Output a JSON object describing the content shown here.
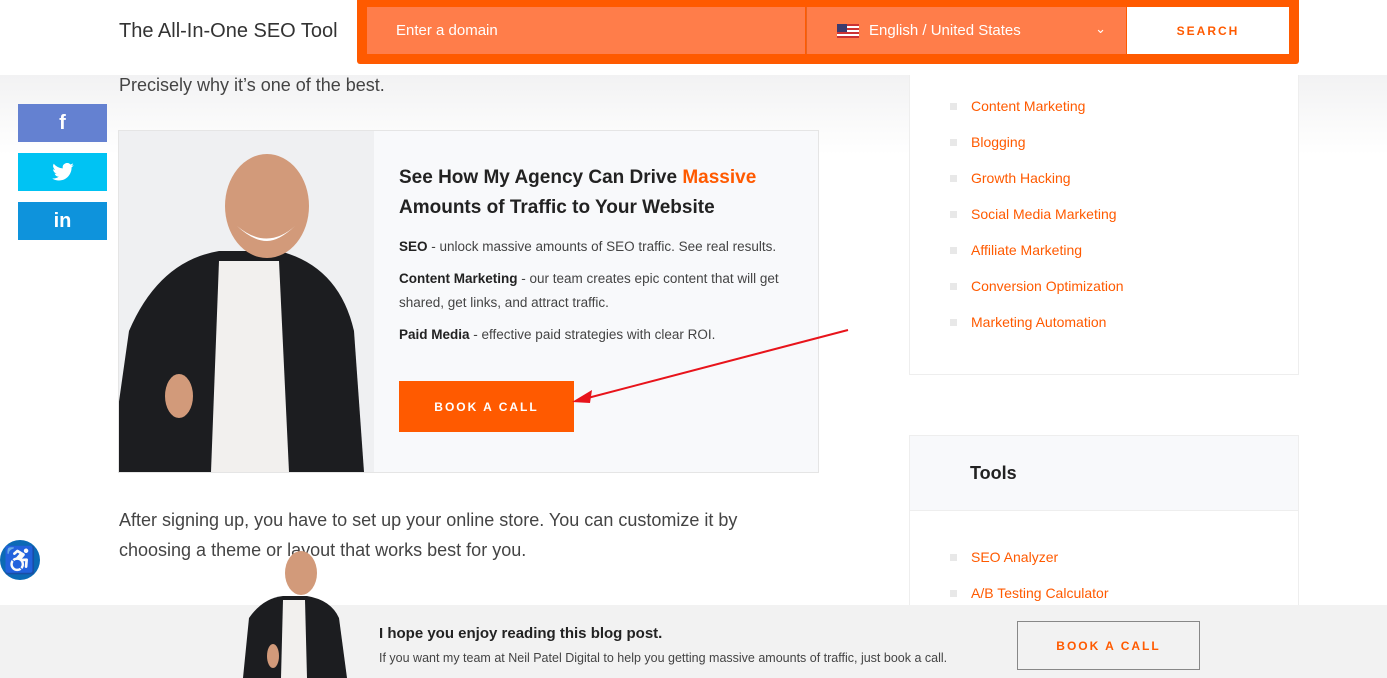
{
  "header": {
    "brand": "The All-In-One SEO Tool",
    "domain_placeholder": "Enter a domain",
    "language": "English / United States",
    "search_label": "SEARCH"
  },
  "intro": "Precisely why it’s one of the best.",
  "social": {
    "facebook": "f",
    "twitter": "🐦",
    "linkedin": "in"
  },
  "card": {
    "title_before": "See How My Agency Can Drive ",
    "title_accent": "Massive",
    "title_after": " Amounts of Traffic to Your Website",
    "items": [
      {
        "label": "SEO",
        "text": " - unlock massive amounts of SEO traffic. See real results."
      },
      {
        "label": "Content Marketing",
        "text": " - our team creates epic content that will get shared, get links, and attract traffic."
      },
      {
        "label": "Paid Media",
        "text": " - effective paid strategies with clear ROI."
      }
    ],
    "button": "BOOK A CALL"
  },
  "body_text": "After signing up, you have to set up your online store. You can customize it by choosing a theme or layout that works best for you.",
  "sidebar": {
    "categories": [
      "Content Marketing",
      "Blogging",
      "Growth Hacking",
      "Social Media Marketing",
      "Affiliate Marketing",
      "Conversion Optimization",
      "Marketing Automation"
    ],
    "tools_title": "Tools",
    "tools": [
      "SEO Analyzer",
      "A/B Testing Calculator"
    ]
  },
  "footer": {
    "title": "I hope you enjoy reading this blog post.",
    "subtitle": "If you want my team at Neil Patel Digital to help you getting massive amounts of traffic, just book a call.",
    "button": "BOOK A CALL"
  },
  "colors": {
    "accent": "#ff5a00",
    "facebook": "#6481d1",
    "twitter": "#00c3f3",
    "linkedin": "#0e93dc",
    "annotation_arrow": "#e8141b"
  }
}
